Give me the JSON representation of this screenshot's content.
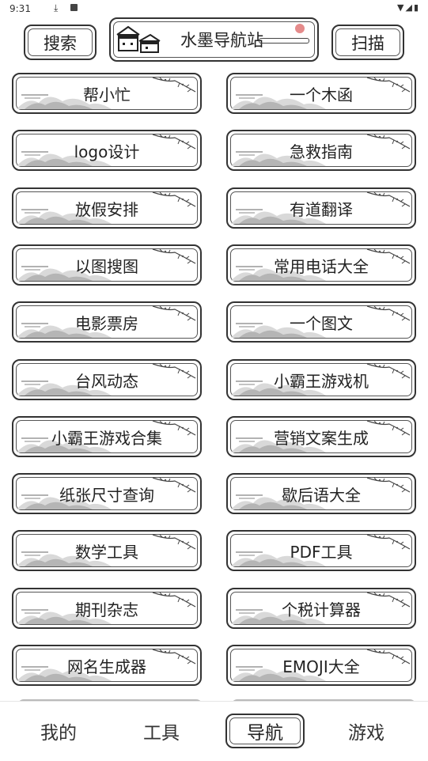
{
  "status_bar": {
    "time": "9:31"
  },
  "header": {
    "search_label": "搜索",
    "title": "水墨导航站",
    "scan_label": "扫描"
  },
  "grid": {
    "items": [
      "帮小忙",
      "一个木函",
      "logo设计",
      "急救指南",
      "放假安排",
      "有道翻译",
      "以图搜图",
      "常用电话大全",
      "电影票房",
      "一个图文",
      "台风动态",
      "小霸王游戏机",
      "小霸王游戏合集",
      "营销文案生成",
      "纸张尺寸查询",
      "歇后语大全",
      "数学工具",
      "PDF工具",
      "期刊杂志",
      "个税计算器",
      "网名生成器",
      "EMOJI大全"
    ]
  },
  "bottom_nav": {
    "mine": "我的",
    "tools": "工具",
    "nav": "导航",
    "games": "游戏",
    "active": "导航"
  },
  "colors": {
    "ink": "#333333",
    "sun": "#e58b8b",
    "background": "#ffffff"
  }
}
